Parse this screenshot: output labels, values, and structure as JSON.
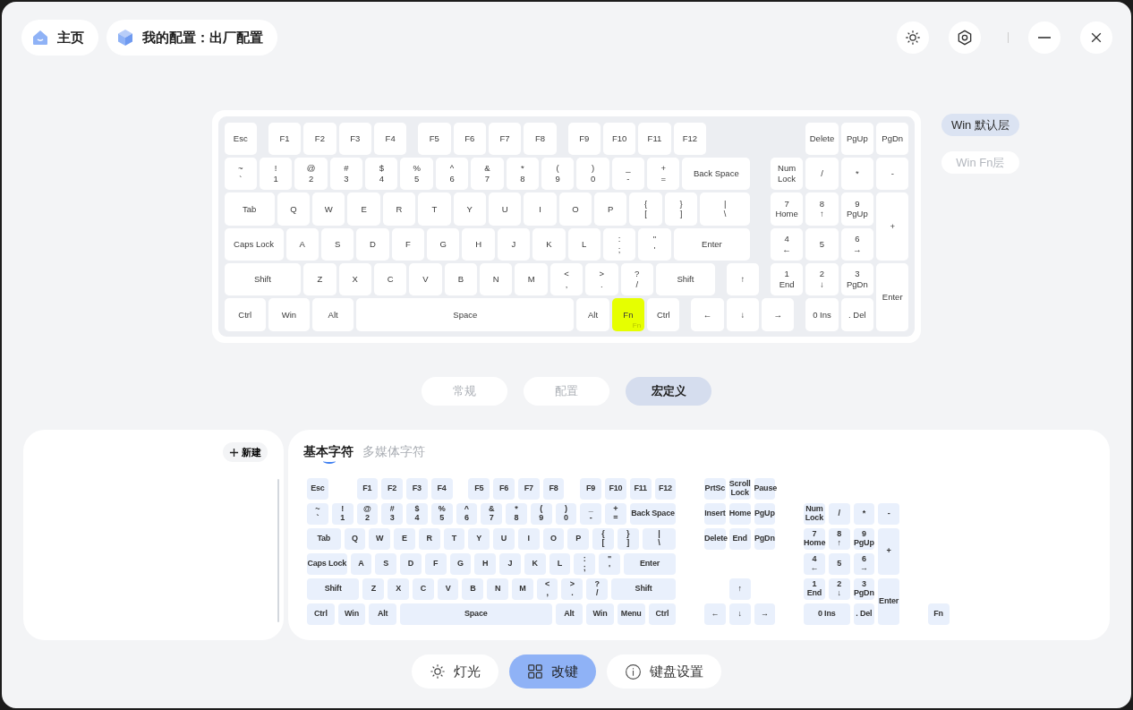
{
  "header": {
    "home": "主页",
    "profile": "我的配置：出厂配置"
  },
  "keyboard": {
    "keys": [
      {
        "label": "Esc",
        "selected": false
      },
      {
        "label": "F1",
        "selected": false
      },
      {
        "label": "F2",
        "selected": false
      },
      {
        "label": "F3",
        "selected": false
      },
      {
        "label": "F4",
        "selected": false
      },
      {
        "label": "F5",
        "selected": false
      },
      {
        "label": "F6",
        "selected": false
      },
      {
        "label": "F7",
        "selected": false
      },
      {
        "label": "F8",
        "selected": false
      },
      {
        "label": "F9",
        "selected": false
      },
      {
        "label": "F10",
        "selected": false
      },
      {
        "label": "F11",
        "selected": false
      },
      {
        "label": "F12",
        "selected": false
      },
      {
        "label": "Delete",
        "selected": false
      },
      {
        "label": "PgUp",
        "selected": false
      },
      {
        "label": "PgDn",
        "selected": false
      },
      {
        "label": "~\n`",
        "selected": false
      },
      {
        "label": "!\n1",
        "selected": false
      },
      {
        "label": "@\n2",
        "selected": false
      },
      {
        "label": "#\n3",
        "selected": false
      },
      {
        "label": "$\n4",
        "selected": false
      },
      {
        "label": "%\n5",
        "selected": false
      },
      {
        "label": "^\n6",
        "selected": false
      },
      {
        "label": "&\n7",
        "selected": false
      },
      {
        "label": "*\n8",
        "selected": false
      },
      {
        "label": "(\n9",
        "selected": false
      },
      {
        "label": ")\n0",
        "selected": false
      },
      {
        "label": "_\n-",
        "selected": false
      },
      {
        "label": "+\n=",
        "selected": false
      },
      {
        "label": "Back Space",
        "selected": false
      },
      {
        "label": "Num\nLock",
        "selected": false
      },
      {
        "label": "/",
        "selected": false
      },
      {
        "label": "*",
        "selected": false
      },
      {
        "label": "-",
        "selected": false
      },
      {
        "label": "Tab",
        "selected": false
      },
      {
        "label": "Q",
        "selected": false
      },
      {
        "label": "W",
        "selected": false
      },
      {
        "label": "E",
        "selected": false
      },
      {
        "label": "R",
        "selected": false
      },
      {
        "label": "T",
        "selected": false
      },
      {
        "label": "Y",
        "selected": false
      },
      {
        "label": "U",
        "selected": false
      },
      {
        "label": "I",
        "selected": false
      },
      {
        "label": "O",
        "selected": false
      },
      {
        "label": "P",
        "selected": false
      },
      {
        "label": "{\n[",
        "selected": false
      },
      {
        "label": "}\n]",
        "selected": false
      },
      {
        "label": "|\n\\",
        "selected": false
      },
      {
        "label": "7\nHome",
        "selected": false
      },
      {
        "label": "8\n↑",
        "selected": false
      },
      {
        "label": "9\nPgUp",
        "selected": false
      },
      {
        "label": "+",
        "selected": false
      },
      {
        "label": "Caps Lock",
        "selected": false
      },
      {
        "label": "A",
        "selected": false
      },
      {
        "label": "S",
        "selected": false
      },
      {
        "label": "D",
        "selected": false
      },
      {
        "label": "F",
        "selected": false
      },
      {
        "label": "G",
        "selected": false
      },
      {
        "label": "H",
        "selected": false
      },
      {
        "label": "J",
        "selected": false
      },
      {
        "label": "K",
        "selected": false
      },
      {
        "label": "L",
        "selected": false
      },
      {
        "label": ":\n;",
        "selected": false
      },
      {
        "label": "\"\n'",
        "selected": false
      },
      {
        "label": "Enter",
        "selected": false
      },
      {
        "label": "4\n←",
        "selected": false
      },
      {
        "label": "5",
        "selected": false
      },
      {
        "label": "6\n→",
        "selected": false
      },
      {
        "label": "Shift",
        "selected": false
      },
      {
        "label": "Z",
        "selected": false
      },
      {
        "label": "X",
        "selected": false
      },
      {
        "label": "C",
        "selected": false
      },
      {
        "label": "V",
        "selected": false
      },
      {
        "label": "B",
        "selected": false
      },
      {
        "label": "N",
        "selected": false
      },
      {
        "label": "M",
        "selected": false
      },
      {
        "label": "<\n,",
        "selected": false
      },
      {
        "label": ">\n.",
        "selected": false
      },
      {
        "label": "?\n/",
        "selected": false
      },
      {
        "label": "Shift",
        "selected": false
      },
      {
        "label": "↑",
        "selected": false
      },
      {
        "label": "1\nEnd",
        "selected": false
      },
      {
        "label": "2\n↓",
        "selected": false
      },
      {
        "label": "3\nPgDn",
        "selected": false
      },
      {
        "label": "Enter",
        "selected": false
      },
      {
        "label": "Ctrl",
        "selected": false
      },
      {
        "label": "Win",
        "selected": false
      },
      {
        "label": "Alt",
        "selected": false
      },
      {
        "label": "Space",
        "selected": false
      },
      {
        "label": "Alt",
        "selected": false
      },
      {
        "label": "Fn",
        "sub": "Fn",
        "selected": true
      },
      {
        "label": "Ctrl",
        "selected": false
      },
      {
        "label": "←",
        "selected": false
      },
      {
        "label": "↓",
        "selected": false
      },
      {
        "label": "→",
        "selected": false
      },
      {
        "label": "0 Ins",
        "selected": false
      },
      {
        "label": ". Del",
        "selected": false
      }
    ]
  },
  "layers": [
    {
      "label": "Win 默认层",
      "selected": true
    },
    {
      "label": "Win Fn层",
      "selected": false
    }
  ],
  "mode_tabs": [
    {
      "label": "常规",
      "selected": false
    },
    {
      "label": "配置",
      "selected": false
    },
    {
      "label": "宏定义",
      "selected": true
    }
  ],
  "macro_panel": {
    "new_button": "新建"
  },
  "char_tabs": [
    {
      "label": "基本字符",
      "selected": true
    },
    {
      "label": "多媒体字符",
      "selected": false
    }
  ],
  "palette": {
    "keys": [
      "Esc",
      "F1",
      "F2",
      "F3",
      "F4",
      "F5",
      "F6",
      "F7",
      "F8",
      "F9",
      "F10",
      "F11",
      "F12",
      "PrtSc",
      "Scroll\nLock",
      "Pause",
      "~\n`",
      "!\n1",
      "@\n2",
      "#\n3",
      "$\n4",
      "%\n5",
      "^\n6",
      "&\n7",
      "*\n8",
      "(\n9",
      ")\n0",
      "_\n-",
      "+\n=",
      "Back Space",
      "Insert",
      "Home",
      "PgUp",
      "Num\nLock",
      "/",
      "*",
      "-",
      "Tab",
      "Q",
      "W",
      "E",
      "R",
      "T",
      "Y",
      "U",
      "I",
      "O",
      "P",
      "{\n[",
      "}\n]",
      "|\n\\",
      "Delete",
      "End",
      "PgDn",
      "7\nHome",
      "8\n↑",
      "9\nPgUp",
      "+",
      "Caps Lock",
      "A",
      "S",
      "D",
      "F",
      "G",
      "H",
      "J",
      "K",
      "L",
      ":\n;",
      "\"\n'",
      "Enter",
      "4\n←",
      "5",
      "6\n→",
      "Shift",
      "Z",
      "X",
      "C",
      "V",
      "B",
      "N",
      "M",
      "<\n,",
      ">\n.",
      "?\n/",
      "Shift",
      "↑",
      "1\nEnd",
      "2\n↓",
      "3\nPgDn",
      "Enter",
      "Ctrl",
      "Win",
      "Alt",
      "Space",
      "Alt",
      "Win",
      "Menu",
      "Ctrl",
      "←",
      "↓",
      "→",
      "0 Ins",
      ". Del",
      "Fn"
    ]
  },
  "bottom_nav": [
    {
      "label": "灯光",
      "selected": false
    },
    {
      "label": "改键",
      "selected": true
    },
    {
      "label": "键盘设置",
      "selected": false
    }
  ]
}
